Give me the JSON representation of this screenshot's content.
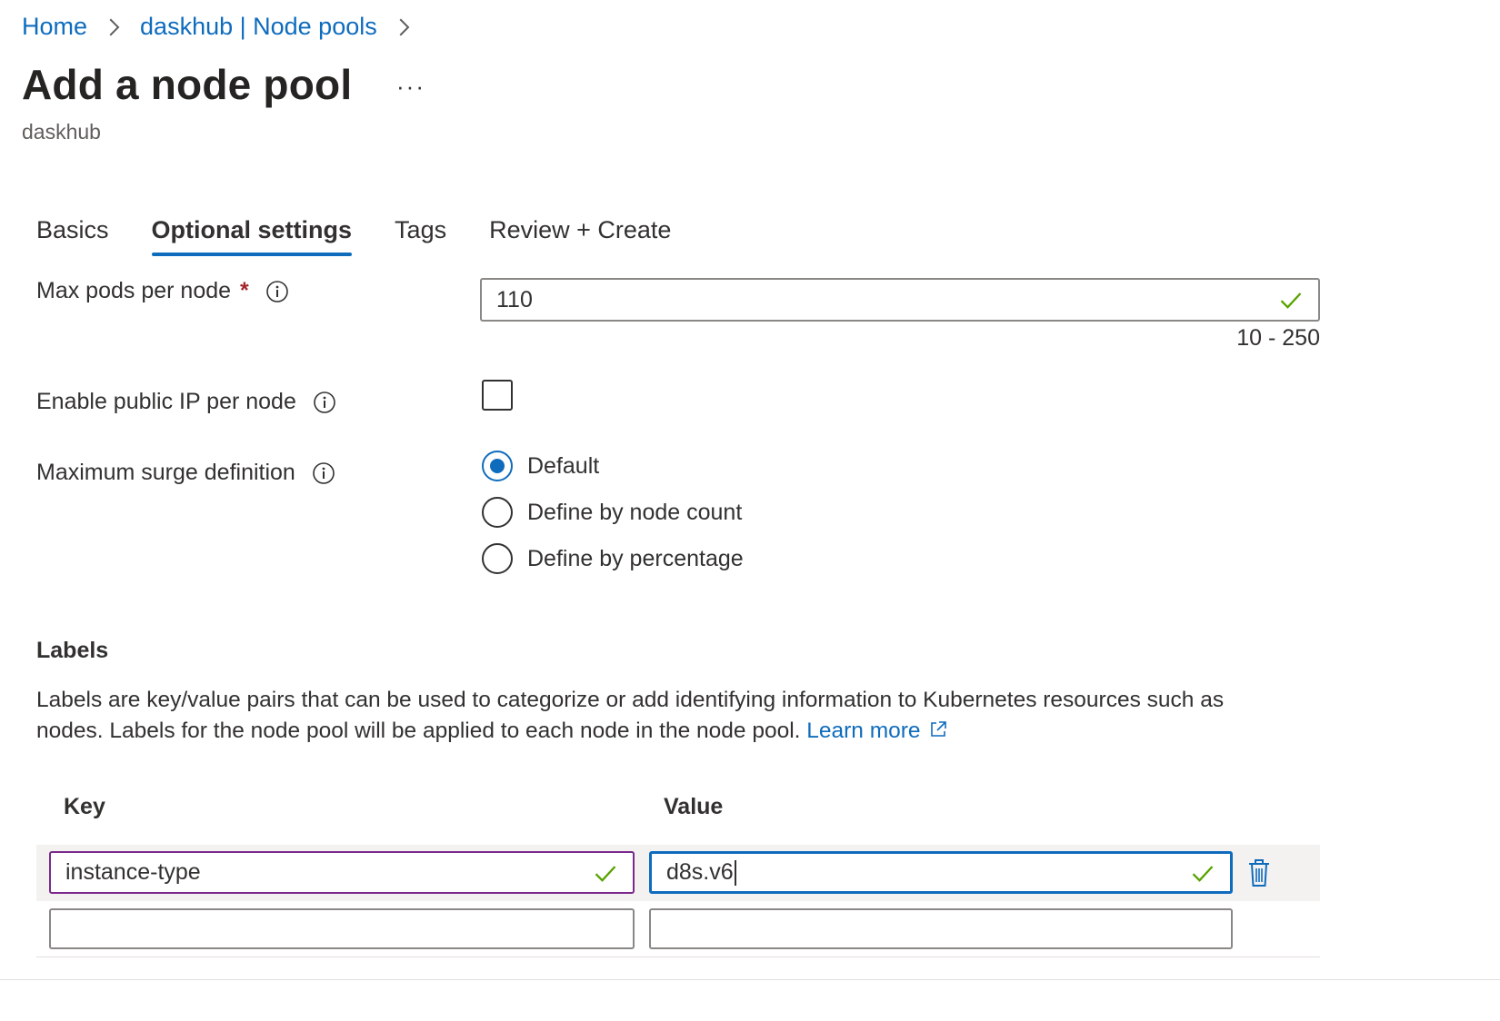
{
  "breadcrumb": {
    "items": [
      "Home",
      "daskhub | Node pools"
    ]
  },
  "page": {
    "title": "Add a node pool",
    "more_label": "···",
    "subtitle": "daskhub"
  },
  "tabs": [
    {
      "label": "Basics",
      "active": false
    },
    {
      "label": "Optional settings",
      "active": true
    },
    {
      "label": "Tags",
      "active": false
    },
    {
      "label": "Review + Create",
      "active": false
    }
  ],
  "form": {
    "max_pods": {
      "label": "Max pods per node",
      "required_mark": "*",
      "value": "110",
      "range_hint": "10 - 250"
    },
    "public_ip": {
      "label": "Enable public IP per node",
      "checked": false
    },
    "surge": {
      "label": "Maximum surge definition",
      "options": [
        {
          "label": "Default",
          "selected": true
        },
        {
          "label": "Define by node count",
          "selected": false
        },
        {
          "label": "Define by percentage",
          "selected": false
        }
      ]
    }
  },
  "labels_section": {
    "title": "Labels",
    "description_line1": "Labels are key/value pairs that can be used to categorize or add identifying information to Kubernetes resources such as",
    "description_line2": "nodes. Labels for the node pool will be applied to each node in the node pool.",
    "learn_more": "Learn more",
    "key_header": "Key",
    "value_header": "Value",
    "rows": [
      {
        "key": "instance-type",
        "value": "d8s.v6"
      },
      {
        "key": "",
        "value": ""
      }
    ]
  },
  "colors": {
    "accent": "#0f6cbd",
    "valid_check": "#57a300",
    "focused_key_border": "#7a2a8c",
    "required": "#a4262c"
  },
  "icons": [
    "chevron-right-icon",
    "info-icon",
    "checkmark-icon",
    "external-link-icon",
    "trash-icon"
  ]
}
